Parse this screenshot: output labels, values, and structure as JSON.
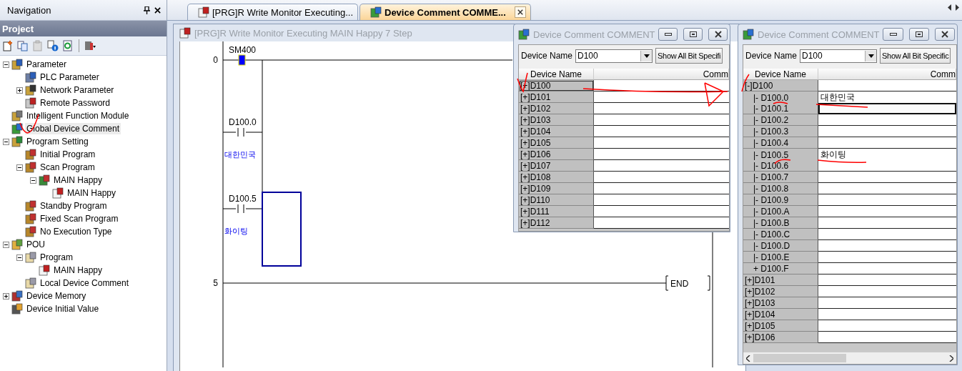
{
  "navigation": {
    "title": "Navigation",
    "section": "Project",
    "tree": [
      {
        "label": "Parameter",
        "kind": "parameter",
        "expanded": true,
        "selected": false,
        "children": [
          {
            "label": "PLC Parameter",
            "kind": "plc",
            "selected": false
          },
          {
            "label": "Network Parameter",
            "kind": "network",
            "expanded": false,
            "selected": false
          },
          {
            "label": "Remote Password",
            "kind": "password",
            "selected": false
          }
        ]
      },
      {
        "label": "Intelligent Function Module",
        "kind": "module",
        "selected": false
      },
      {
        "label": "Global Device Comment",
        "kind": "globe",
        "selected": true
      },
      {
        "label": "Program Setting",
        "kind": "setting",
        "expanded": true,
        "selected": false,
        "children": [
          {
            "label": "Initial Program",
            "kind": "program",
            "selected": false
          },
          {
            "label": "Scan Program",
            "kind": "program",
            "expanded": true,
            "selected": false,
            "children": [
              {
                "label": "MAIN Happy",
                "kind": "task",
                "expanded": true,
                "selected": false,
                "children": [
                  {
                    "label": "MAIN Happy",
                    "kind": "ladder",
                    "selected": false
                  }
                ]
              }
            ]
          },
          {
            "label": "Standby Program",
            "kind": "program",
            "selected": false
          },
          {
            "label": "Fixed Scan Program",
            "kind": "program",
            "selected": false
          },
          {
            "label": "No Execution Type",
            "kind": "program",
            "selected": false
          }
        ]
      },
      {
        "label": "POU",
        "kind": "pou",
        "expanded": true,
        "selected": false,
        "children": [
          {
            "label": "Program",
            "kind": "folder",
            "expanded": true,
            "selected": false,
            "children": [
              {
                "label": "MAIN Happy",
                "kind": "ladder",
                "selected": false
              }
            ]
          },
          {
            "label": "Local Device Comment",
            "kind": "folder",
            "selected": false
          }
        ]
      },
      {
        "label": "Device Memory",
        "kind": "memory",
        "expanded": false,
        "selected": false
      },
      {
        "label": "Device Initial Value",
        "kind": "initial",
        "selected": false
      }
    ]
  },
  "tabs": [
    {
      "label": "[PRG]R Write Monitor Executing...",
      "kind": "ladder",
      "selected": false
    },
    {
      "label": "Device Comment COMME...",
      "kind": "globe",
      "selected": true
    }
  ],
  "ladder": {
    "title": "[PRG]R Write Monitor Executing MAIN Happy 7 Step",
    "rungs": [
      {
        "step": "0",
        "contacts": [
          {
            "device": "SM400",
            "on": true
          },
          {
            "device": "D100.0",
            "comment": "대한민국",
            "on": false
          },
          {
            "device": "D100.5",
            "comment": "화이팅",
            "on": false
          }
        ]
      },
      {
        "step": "5",
        "instruction": "END"
      }
    ]
  },
  "comment_windows": [
    {
      "title": "Device Comment COMMENT",
      "device_name_label": "Device Name",
      "device_name_value": "D100",
      "button": "Show All Bit Specifi",
      "columns": [
        "Device Name",
        "Comm"
      ],
      "rows": [
        {
          "device": "[+]D100",
          "kind": "word",
          "device_selected": true,
          "comment_selected": false
        },
        {
          "device": "[+]D101",
          "kind": "word",
          "device_selected": false,
          "comment_selected": false
        },
        {
          "device": "[+]D102",
          "kind": "word",
          "device_selected": false,
          "comment_selected": false
        },
        {
          "device": "[+]D103",
          "kind": "word",
          "device_selected": false,
          "comment_selected": false
        },
        {
          "device": "[+]D104",
          "kind": "word",
          "device_selected": false,
          "comment_selected": false
        },
        {
          "device": "[+]D105",
          "kind": "word",
          "device_selected": false,
          "comment_selected": false
        },
        {
          "device": "[+]D106",
          "kind": "word",
          "device_selected": false,
          "comment_selected": false
        },
        {
          "device": "[+]D107",
          "kind": "word",
          "device_selected": false,
          "comment_selected": false
        },
        {
          "device": "[+]D108",
          "kind": "word",
          "device_selected": false,
          "comment_selected": false
        },
        {
          "device": "[+]D109",
          "kind": "word",
          "device_selected": false,
          "comment_selected": false
        },
        {
          "device": "[+]D110",
          "kind": "word",
          "device_selected": false,
          "comment_selected": false
        },
        {
          "device": "[+]D111",
          "kind": "word",
          "device_selected": false,
          "comment_selected": false
        },
        {
          "device": "[+]D112",
          "kind": "word",
          "device_selected": false,
          "comment_selected": false
        }
      ]
    },
    {
      "title": "Device Comment COMMENT",
      "device_name_label": "Device Name",
      "device_name_value": "D100",
      "button": "Show All Bit Specific",
      "columns": [
        "Device Name",
        "Comm"
      ],
      "rows": [
        {
          "device": "[-]D100",
          "kind": "word",
          "device_selected": false,
          "comment_selected": false
        },
        {
          "device": "|- D100.0",
          "comment": "대한민국",
          "kind": "bit",
          "device_selected": false,
          "comment_selected": false
        },
        {
          "device": "|- D100.1",
          "kind": "bit",
          "device_selected": false,
          "comment_selected": true
        },
        {
          "device": "|- D100.2",
          "kind": "bit",
          "device_selected": false,
          "comment_selected": false
        },
        {
          "device": "|- D100.3",
          "kind": "bit",
          "device_selected": false,
          "comment_selected": false
        },
        {
          "device": "|- D100.4",
          "kind": "bit",
          "device_selected": false,
          "comment_selected": false
        },
        {
          "device": "|- D100.5",
          "comment": "화이팅",
          "kind": "bit",
          "device_selected": false,
          "comment_selected": false
        },
        {
          "device": "|- D100.6",
          "kind": "bit",
          "device_selected": false,
          "comment_selected": false
        },
        {
          "device": "|- D100.7",
          "kind": "bit",
          "device_selected": false,
          "comment_selected": false
        },
        {
          "device": "|- D100.8",
          "kind": "bit",
          "device_selected": false,
          "comment_selected": false
        },
        {
          "device": "|- D100.9",
          "kind": "bit",
          "device_selected": false,
          "comment_selected": false
        },
        {
          "device": "|- D100.A",
          "kind": "bit",
          "device_selected": false,
          "comment_selected": false
        },
        {
          "device": "|- D100.B",
          "kind": "bit",
          "device_selected": false,
          "comment_selected": false
        },
        {
          "device": "|- D100.C",
          "kind": "bit",
          "device_selected": false,
          "comment_selected": false
        },
        {
          "device": "|- D100.D",
          "kind": "bit",
          "device_selected": false,
          "comment_selected": false
        },
        {
          "device": "|- D100.E",
          "kind": "bit",
          "device_selected": false,
          "comment_selected": false
        },
        {
          "device": "+ D100.F",
          "kind": "bit",
          "device_selected": false,
          "comment_selected": false
        },
        {
          "device": "[+]D101",
          "kind": "word",
          "device_selected": false,
          "comment_selected": false
        },
        {
          "device": "[+]D102",
          "kind": "word",
          "device_selected": false,
          "comment_selected": false
        },
        {
          "device": "[+]D103",
          "kind": "word",
          "device_selected": false,
          "comment_selected": false
        },
        {
          "device": "[+]D104",
          "kind": "word",
          "device_selected": false,
          "comment_selected": false
        },
        {
          "device": "[+]D105",
          "kind": "word",
          "device_selected": false,
          "comment_selected": false
        },
        {
          "device": "[+]D106",
          "kind": "word",
          "device_selected": false,
          "comment_selected": false
        }
      ]
    }
  ]
}
